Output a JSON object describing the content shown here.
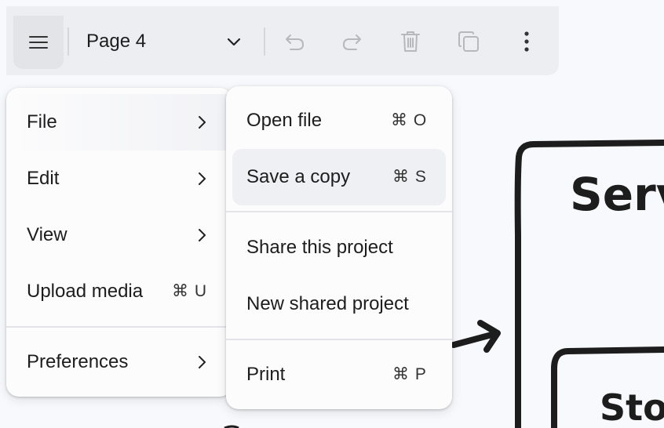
{
  "toolbar": {
    "page_name": "Page 4",
    "icons": [
      "menu-icon",
      "chevron-down-icon",
      "undo-icon",
      "redo-icon",
      "trash-icon",
      "duplicate-icon",
      "more-vertical-icon"
    ]
  },
  "main_menu": {
    "items": [
      {
        "label": "File",
        "submenu": true
      },
      {
        "label": "Edit",
        "submenu": true
      },
      {
        "label": "View",
        "submenu": true
      },
      {
        "label": "Upload media",
        "shortcut": "⌘ U"
      },
      {
        "label": "Preferences",
        "submenu": true
      }
    ]
  },
  "file_menu": {
    "items": [
      {
        "label": "Open file",
        "shortcut": "⌘ O"
      },
      {
        "label": "Save a copy",
        "shortcut": "⌘ S"
      },
      {
        "label": "Share this project"
      },
      {
        "label": "New shared project"
      },
      {
        "label": "Print",
        "shortcut": "⌘ P"
      }
    ]
  },
  "canvas": {
    "text_1": "Serv",
    "text_2": "Sto"
  },
  "colors": {
    "toolbar_bg": "#edeef1",
    "menu_bg": "#fcfcfd",
    "hover_bg": "#eff0f3",
    "ink": "#1d1d1d"
  }
}
